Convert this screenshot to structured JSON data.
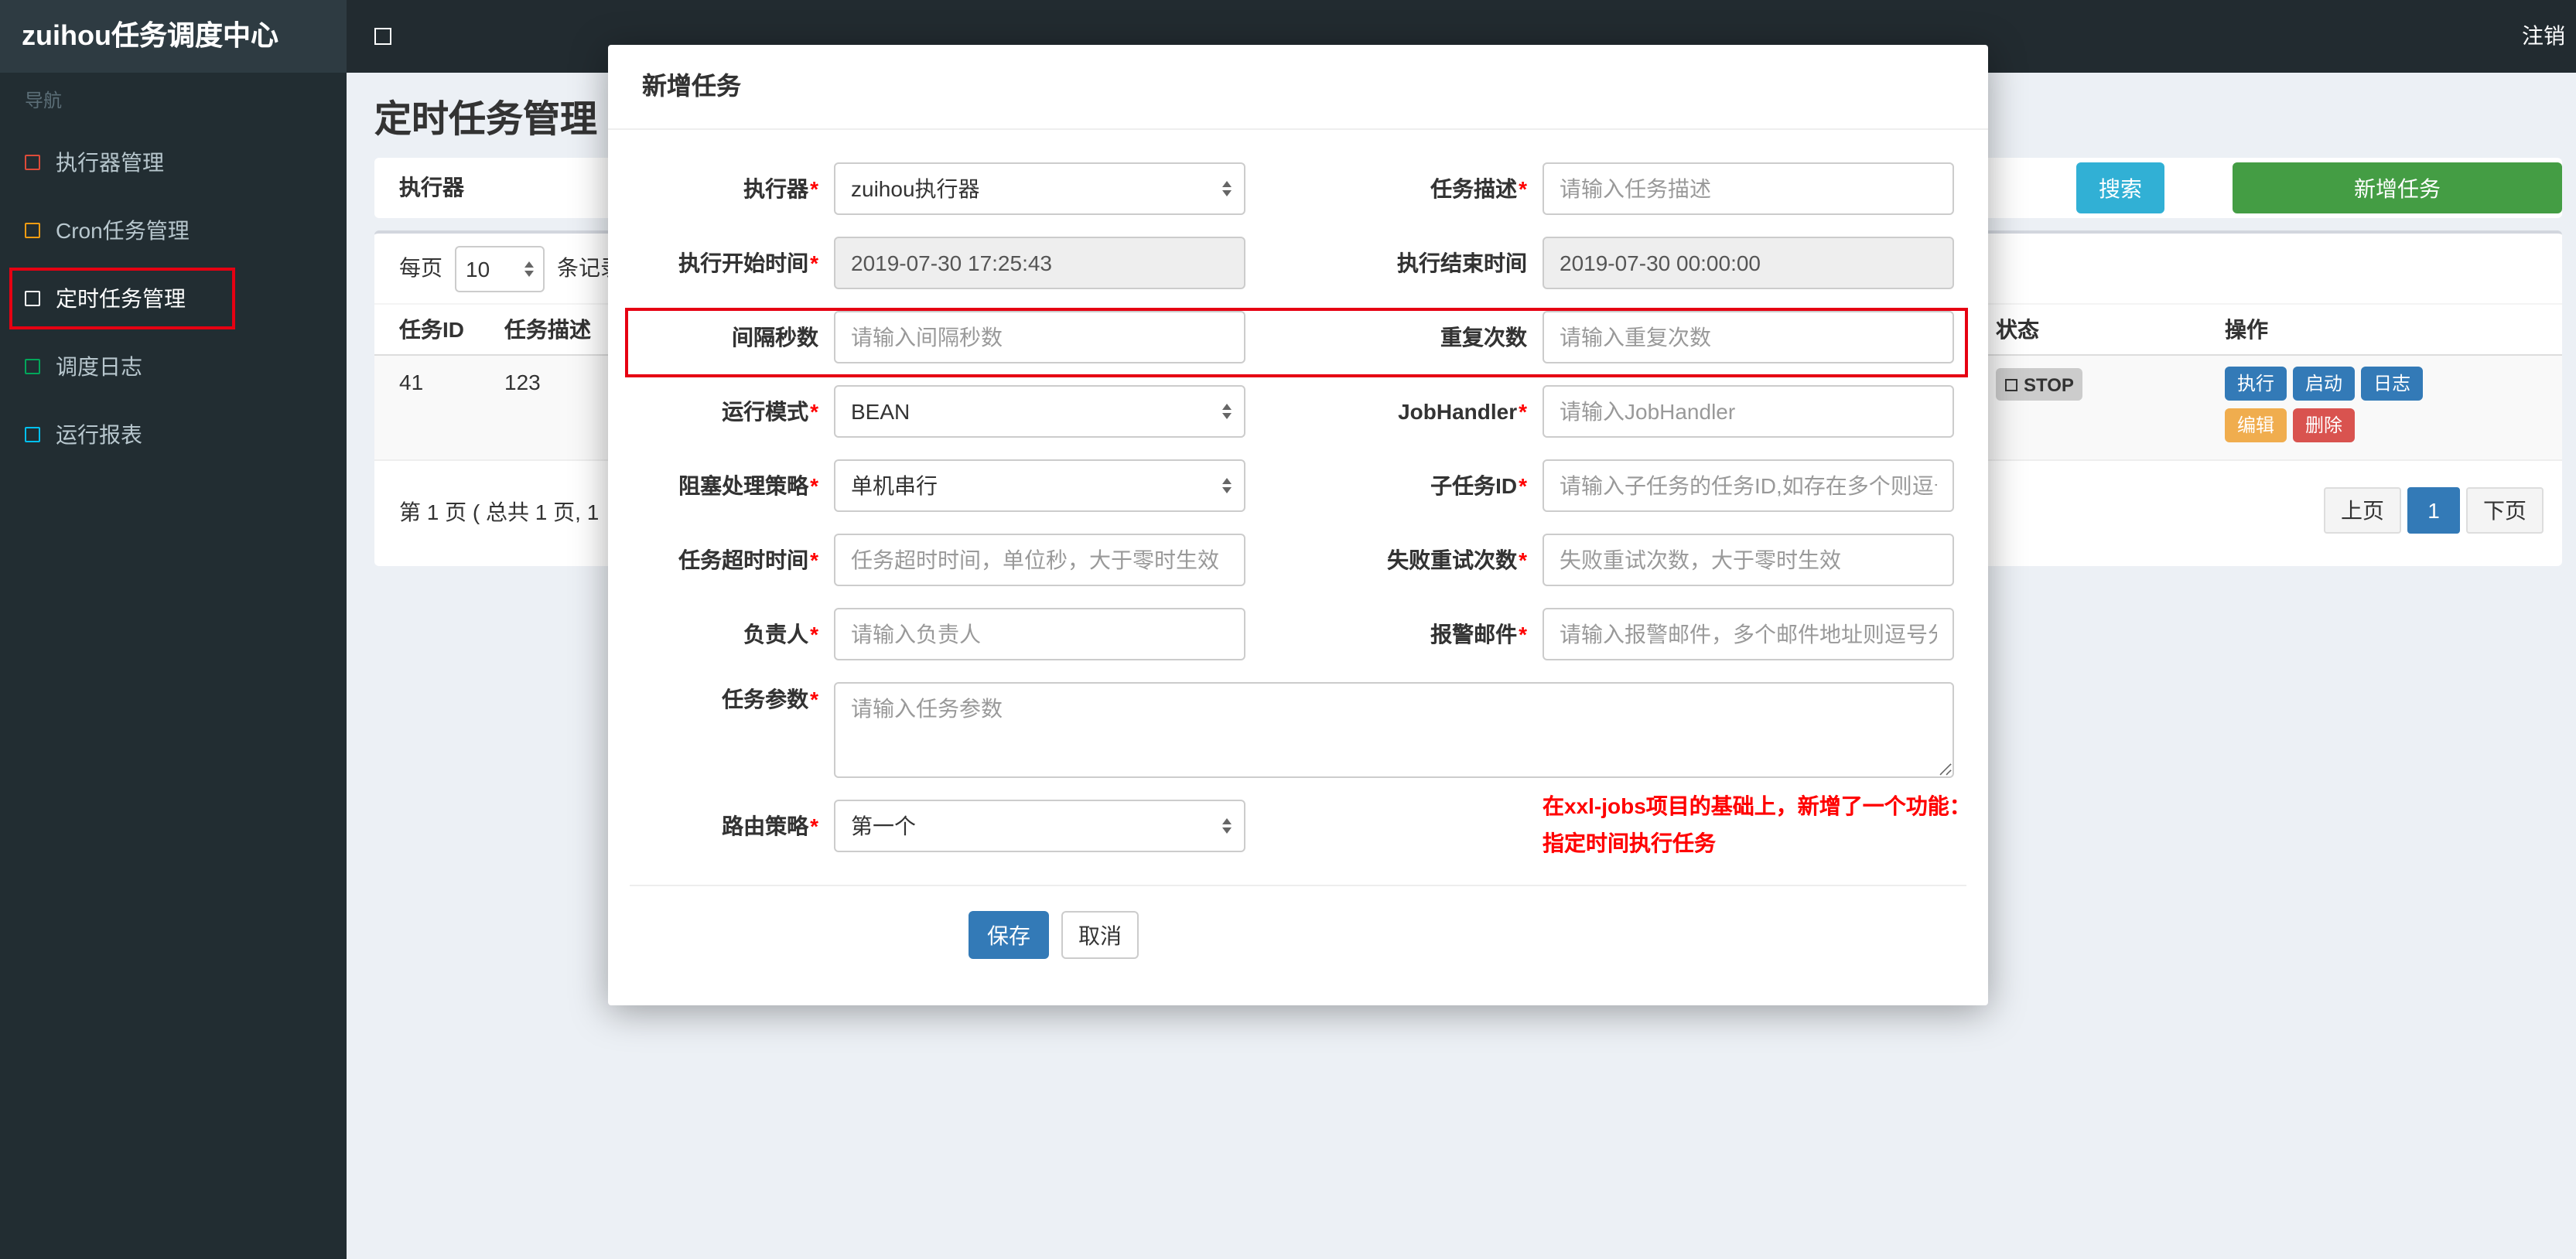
{
  "brand": "zuihou任务调度中心",
  "topbar": {
    "logout": "注销"
  },
  "sidebar": {
    "nav_label": "导航",
    "items": [
      {
        "label": "执行器管理",
        "icon_color": "#dd4b39"
      },
      {
        "label": "Cron任务管理",
        "icon_color": "#f39c12"
      },
      {
        "label": "定时任务管理",
        "icon_color": "#ffffff",
        "active": true
      },
      {
        "label": "调度日志",
        "icon_color": "#00a65a"
      },
      {
        "label": "运行报表",
        "icon_color": "#00c0ef"
      }
    ]
  },
  "page": {
    "title": "定时任务管理",
    "filter": {
      "executor_label": "执行器",
      "search_button": "搜索",
      "add_button": "新增任务"
    },
    "toolbar": {
      "per_page_label": "每页",
      "per_page_value": "10",
      "per_page_suffix": "条记录"
    },
    "table": {
      "headers": [
        "任务ID",
        "任务描述",
        "状态",
        "操作"
      ],
      "row": {
        "id": "41",
        "desc": "123",
        "status": "STOP",
        "actions": [
          {
            "label": "执行",
            "color": "#337ab7"
          },
          {
            "label": "启动",
            "color": "#337ab7"
          },
          {
            "label": "日志",
            "color": "#337ab7"
          },
          {
            "label": "编辑",
            "color": "#f0ad4e"
          },
          {
            "label": "删除",
            "color": "#d9534f"
          }
        ]
      }
    },
    "pagination": {
      "summary": "第 1 页 ( 总共 1 页, 1",
      "prev": "上页",
      "current": "1",
      "next": "下页"
    }
  },
  "modal": {
    "title": "新增任务",
    "required_mark": "*",
    "fields": {
      "executor": {
        "label": "执行器",
        "value": "zuihou执行器"
      },
      "job_desc": {
        "label": "任务描述",
        "placeholder": "请输入任务描述"
      },
      "start_time": {
        "label": "执行开始时间",
        "value": "2019-07-30 17:25:43"
      },
      "end_time": {
        "label": "执行结束时间",
        "value": "2019-07-30 00:00:00"
      },
      "interval": {
        "label": "间隔秒数",
        "placeholder": "请输入间隔秒数"
      },
      "repeat": {
        "label": "重复次数",
        "placeholder": "请输入重复次数"
      },
      "glue_type": {
        "label": "运行模式",
        "value": "BEAN"
      },
      "job_handler": {
        "label": "JobHandler",
        "placeholder": "请输入JobHandler"
      },
      "block_strategy": {
        "label": "阻塞处理策略",
        "value": "单机串行"
      },
      "child_job": {
        "label": "子任务ID",
        "placeholder": "请输入子任务的任务ID,如存在多个则逗号分隔"
      },
      "timeout": {
        "label": "任务超时时间",
        "placeholder": "任务超时时间，单位秒，大于零时生效"
      },
      "fail_retry": {
        "label": "失败重试次数",
        "placeholder": "失败重试次数，大于零时生效"
      },
      "author": {
        "label": "负责人",
        "placeholder": "请输入负责人"
      },
      "alarm_email": {
        "label": "报警邮件",
        "placeholder": "请输入报警邮件，多个邮件地址则逗号分隔"
      },
      "job_param": {
        "label": "任务参数",
        "placeholder": "请输入任务参数"
      },
      "route_strategy": {
        "label": "路由策略",
        "value": "第一个"
      }
    },
    "note_line1": "在xxl-jobs项目的基础上，新增了一个功能：",
    "note_line2": "指定时间执行任务",
    "save_button": "保存",
    "cancel_button": "取消"
  },
  "colors": {
    "accent_blue": "#337ab7",
    "teal": "#31b0d5",
    "green": "#449d44",
    "annotation_red": "#e60012",
    "status_badge_bg": "#cccccc"
  }
}
